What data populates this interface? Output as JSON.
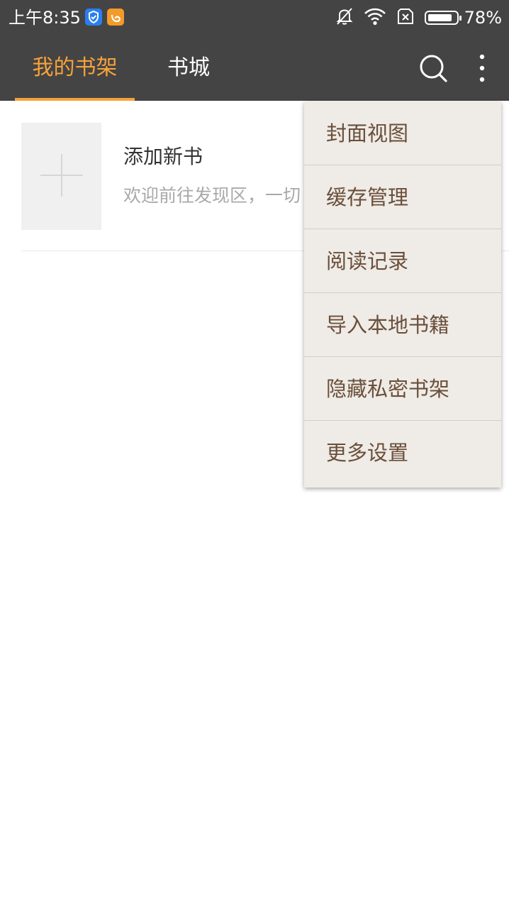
{
  "status_bar": {
    "time": "上午8:35",
    "battery_percent": "78%",
    "icons": [
      "shield-app-icon",
      "uc-browser-icon",
      "mute-bell-icon",
      "wifi-icon",
      "no-sim-icon",
      "battery-icon"
    ]
  },
  "toolbar": {
    "tabs": [
      {
        "label": "我的书架",
        "active": true
      },
      {
        "label": "书城",
        "active": false
      }
    ],
    "icons": [
      "search-icon",
      "more-vert-icon"
    ],
    "accent_color": "#f7a23b",
    "background_color": "#444444"
  },
  "shelf": {
    "add_book": {
      "title": "添加新书",
      "subtitle": "欢迎前往发现区，一切"
    }
  },
  "overflow_menu": {
    "items": [
      "封面视图",
      "缓存管理",
      "阅读记录",
      "导入本地书籍",
      "隐藏私密书架",
      "更多设置"
    ],
    "background_color": "#efebe6",
    "text_color": "#6a4f3b"
  }
}
